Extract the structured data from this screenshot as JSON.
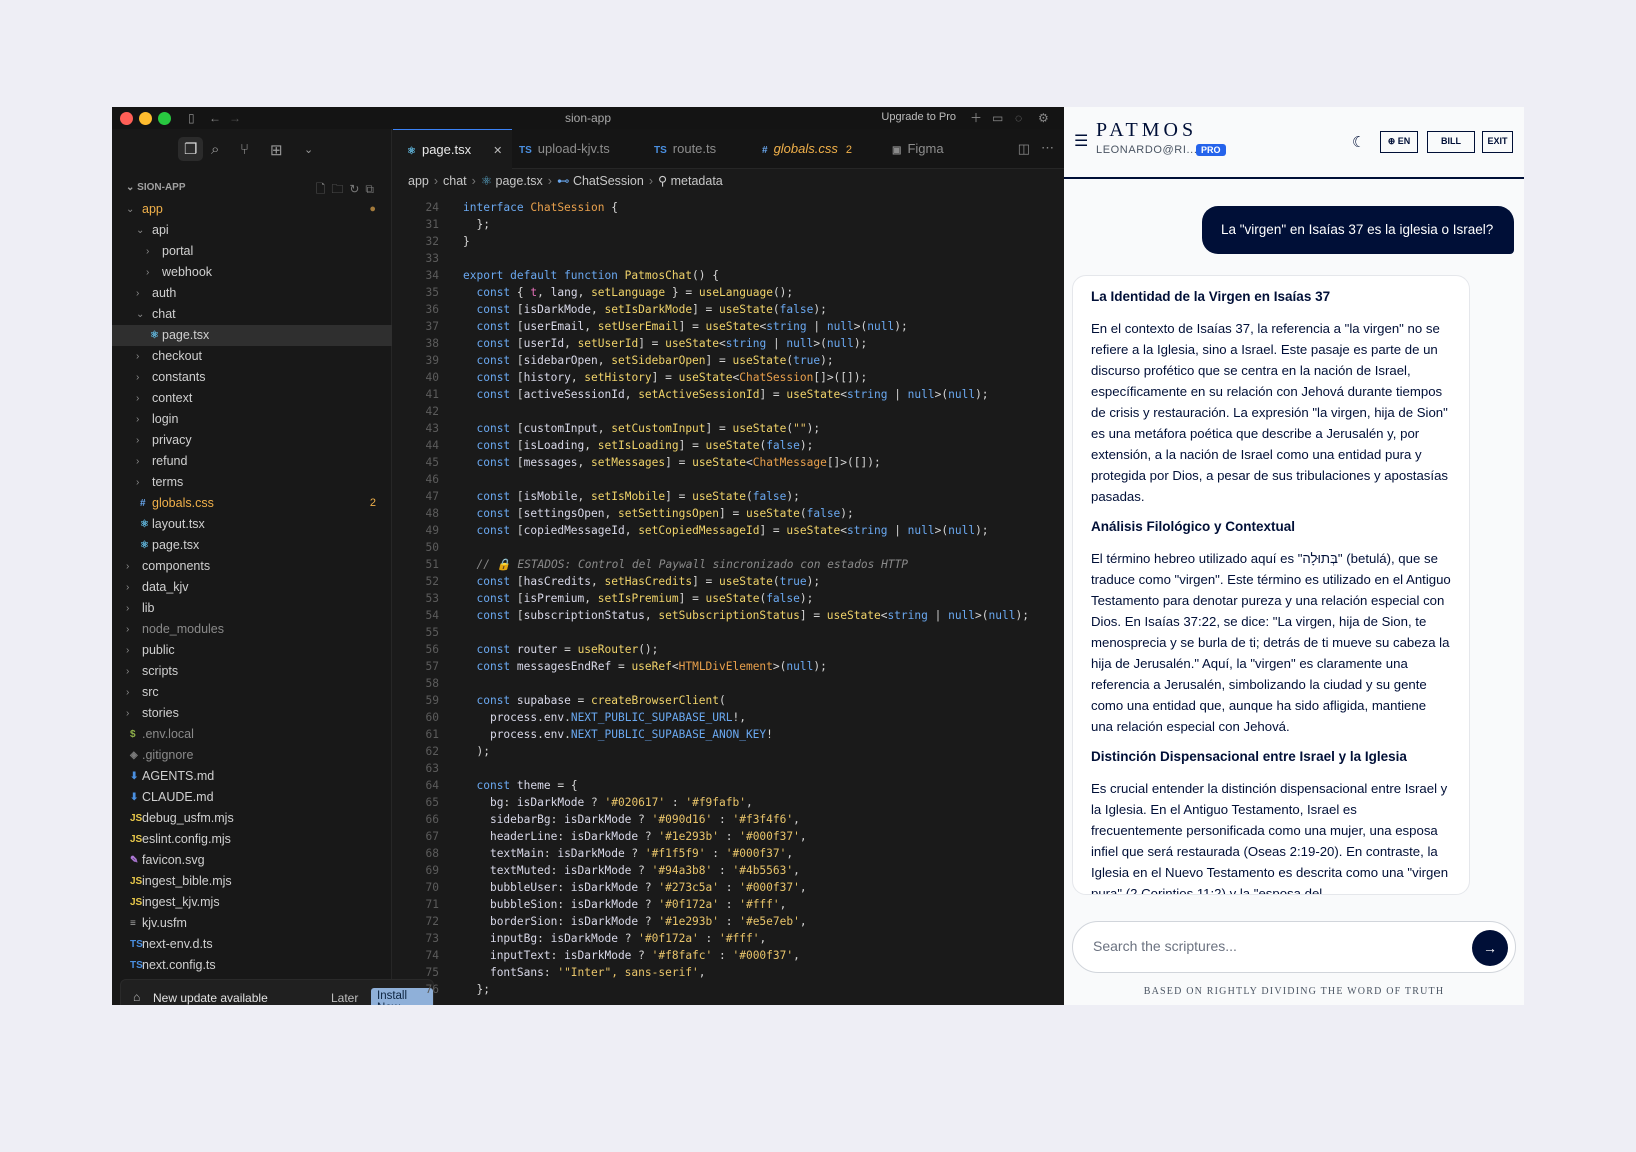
{
  "editor": {
    "window_title": "sion-app",
    "upgrade_label": "Upgrade to Pro",
    "explorer_header": "SION-APP",
    "tree": [
      {
        "name": "app",
        "kind": "folder",
        "open": true,
        "depth": 0,
        "color": "#f0b04a",
        "dot": "#a37a3b"
      },
      {
        "name": "api",
        "kind": "folder",
        "open": true,
        "depth": 1
      },
      {
        "name": "portal",
        "kind": "folder",
        "open": false,
        "depth": 2
      },
      {
        "name": "webhook",
        "kind": "folder",
        "open": false,
        "depth": 2
      },
      {
        "name": "auth",
        "kind": "folder",
        "open": false,
        "depth": 1
      },
      {
        "name": "chat",
        "kind": "folder",
        "open": true,
        "depth": 1
      },
      {
        "name": "page.tsx",
        "kind": "file",
        "icon": "react-icon",
        "depth": 2,
        "selected": true
      },
      {
        "name": "checkout",
        "kind": "folder",
        "open": false,
        "depth": 1
      },
      {
        "name": "constants",
        "kind": "folder",
        "open": false,
        "depth": 1
      },
      {
        "name": "context",
        "kind": "folder",
        "open": false,
        "depth": 1
      },
      {
        "name": "login",
        "kind": "folder",
        "open": false,
        "depth": 1
      },
      {
        "name": "privacy",
        "kind": "folder",
        "open": false,
        "depth": 1
      },
      {
        "name": "refund",
        "kind": "folder",
        "open": false,
        "depth": 1
      },
      {
        "name": "terms",
        "kind": "folder",
        "open": false,
        "depth": 1
      },
      {
        "name": "globals.css",
        "kind": "file",
        "icon": "hash-icon",
        "depth": 1,
        "color": "#f0b04a",
        "badge": "2"
      },
      {
        "name": "layout.tsx",
        "kind": "file",
        "icon": "react-icon",
        "depth": 1
      },
      {
        "name": "page.tsx",
        "kind": "file",
        "icon": "react-icon",
        "depth": 1
      },
      {
        "name": "components",
        "kind": "folder",
        "open": false,
        "depth": 0
      },
      {
        "name": "data_kjv",
        "kind": "folder",
        "open": false,
        "depth": 0
      },
      {
        "name": "lib",
        "kind": "folder",
        "open": false,
        "depth": 0
      },
      {
        "name": "node_modules",
        "kind": "folder",
        "open": false,
        "depth": 0,
        "color": "#8a8a8a"
      },
      {
        "name": "public",
        "kind": "folder",
        "open": false,
        "depth": 0
      },
      {
        "name": "scripts",
        "kind": "folder",
        "open": false,
        "depth": 0
      },
      {
        "name": "src",
        "kind": "folder",
        "open": false,
        "depth": 0
      },
      {
        "name": "stories",
        "kind": "folder",
        "open": false,
        "depth": 0
      },
      {
        "name": ".env.local",
        "kind": "file",
        "icon": "dollar-icon",
        "depth": 0,
        "color": "#8a8a8a"
      },
      {
        "name": ".gitignore",
        "kind": "file",
        "icon": "git-icon",
        "depth": 0,
        "color": "#8a8a8a"
      },
      {
        "name": "AGENTS.md",
        "kind": "file",
        "icon": "markdown-icon",
        "depth": 0
      },
      {
        "name": "CLAUDE.md",
        "kind": "file",
        "icon": "markdown-icon",
        "depth": 0
      },
      {
        "name": "debug_usfm.mjs",
        "kind": "file",
        "icon": "js-icon",
        "depth": 0
      },
      {
        "name": "eslint.config.mjs",
        "kind": "file",
        "icon": "js-icon",
        "depth": 0
      },
      {
        "name": "favicon.svg",
        "kind": "file",
        "icon": "svg-icon",
        "depth": 0
      },
      {
        "name": "ingest_bible.mjs",
        "kind": "file",
        "icon": "js-icon",
        "depth": 0
      },
      {
        "name": "ingest_kjv.mjs",
        "kind": "file",
        "icon": "js-icon",
        "depth": 0
      },
      {
        "name": "kjv.usfm",
        "kind": "file",
        "icon": "lines-icon",
        "depth": 0
      },
      {
        "name": "next-env.d.ts",
        "kind": "file",
        "icon": "ts-icon",
        "depth": 0
      },
      {
        "name": "next.config.ts",
        "kind": "file",
        "icon": "ts-icon",
        "depth": 0
      }
    ],
    "update": {
      "message": "New update available",
      "later": "Later",
      "install": "Install Now"
    },
    "tabs": [
      {
        "label": "page.tsx",
        "icon": "react-icon",
        "active": true,
        "close": "✕"
      },
      {
        "label": "upload-kjv.ts",
        "icon": "ts-icon"
      },
      {
        "label": "route.ts",
        "icon": "ts-icon"
      },
      {
        "label": "globals.css",
        "icon": "hash-icon",
        "badge": "2",
        "italic": true
      },
      {
        "label": "Figma",
        "icon": "figma-icon"
      }
    ],
    "breadcrumb": [
      "app",
      "chat",
      "page.tsx",
      "ChatSession",
      "metadata"
    ],
    "code_lines": [
      {
        "n": "24",
        "html": "<span class=\"kw\">interface</span> <span class=\"ty\">ChatSession</span> {"
      },
      {
        "n": "31",
        "html": "  };"
      },
      {
        "n": "32",
        "html": "}"
      },
      {
        "n": "33",
        "html": ""
      },
      {
        "n": "34",
        "html": "<span class=\"kw\">export default function</span> <span class=\"fn\">PatmosChat</span>() {"
      },
      {
        "n": "35",
        "html": "  <span class=\"kw\">const</span> { <span class=\"vr\">t</span>, <span class=\"pr\">lang</span>, <span class=\"fn\">setLanguage</span> } = <span class=\"fn\">useLanguage</span>();"
      },
      {
        "n": "36",
        "html": "  <span class=\"kw\">const</span> [<span class=\"pr\">isDarkMode</span>, <span class=\"fn\">setIsDarkMode</span>] = <span class=\"fn\">useState</span>(<span class=\"kw\">false</span>);"
      },
      {
        "n": "37",
        "html": "  <span class=\"kw\">const</span> [<span class=\"pr\">userEmail</span>, <span class=\"fn\">setUserEmail</span>] = <span class=\"fn\">useState</span>&lt;<span class=\"kw\">string</span> | <span class=\"kw\">null</span>&gt;(<span class=\"kw\">null</span>);"
      },
      {
        "n": "38",
        "html": "  <span class=\"kw\">const</span> [<span class=\"pr\">userId</span>, <span class=\"fn\">setUserId</span>] = <span class=\"fn\">useState</span>&lt;<span class=\"kw\">string</span> | <span class=\"kw\">null</span>&gt;(<span class=\"kw\">null</span>);"
      },
      {
        "n": "39",
        "html": "  <span class=\"kw\">const</span> [<span class=\"pr\">sidebarOpen</span>, <span class=\"fn\">setSidebarOpen</span>] = <span class=\"fn\">useState</span>(<span class=\"kw\">true</span>);"
      },
      {
        "n": "40",
        "html": "  <span class=\"kw\">const</span> [<span class=\"pr\">history</span>, <span class=\"fn\">setHistory</span>] = <span class=\"fn\">useState</span>&lt;<span class=\"ty\">ChatSession</span>[]&gt;([]);"
      },
      {
        "n": "41",
        "html": "  <span class=\"kw\">const</span> [<span class=\"pr\">activeSessionId</span>, <span class=\"fn\">setActiveSessionId</span>] = <span class=\"fn\">useState</span>&lt;<span class=\"kw\">string</span> | <span class=\"kw\">null</span>&gt;(<span class=\"kw\">null</span>);"
      },
      {
        "n": "42",
        "html": ""
      },
      {
        "n": "43",
        "html": "  <span class=\"kw\">const</span> [<span class=\"pr\">customInput</span>, <span class=\"fn\">setCustomInput</span>] = <span class=\"fn\">useState</span>(<span class=\"str\">\"\"</span>);"
      },
      {
        "n": "44",
        "html": "  <span class=\"kw\">const</span> [<span class=\"pr\">isLoading</span>, <span class=\"fn\">setIsLoading</span>] = <span class=\"fn\">useState</span>(<span class=\"kw\">false</span>);"
      },
      {
        "n": "45",
        "html": "  <span class=\"kw\">const</span> [<span class=\"pr\">messages</span>, <span class=\"fn\">setMessages</span>] = <span class=\"fn\">useState</span>&lt;<span class=\"ty\">ChatMessage</span>[]&gt;([]);"
      },
      {
        "n": "46",
        "html": ""
      },
      {
        "n": "47",
        "html": "  <span class=\"kw\">const</span> [<span class=\"pr\">isMobile</span>, <span class=\"fn\">setIsMobile</span>] = <span class=\"fn\">useState</span>(<span class=\"kw\">false</span>);"
      },
      {
        "n": "48",
        "html": "  <span class=\"kw\">const</span> [<span class=\"pr\">settingsOpen</span>, <span class=\"fn\">setSettingsOpen</span>] = <span class=\"fn\">useState</span>(<span class=\"kw\">false</span>);"
      },
      {
        "n": "49",
        "html": "  <span class=\"kw\">const</span> [<span class=\"pr\">copiedMessageId</span>, <span class=\"fn\">setCopiedMessageId</span>] = <span class=\"fn\">useState</span>&lt;<span class=\"kw\">string</span> | <span class=\"kw\">null</span>&gt;(<span class=\"kw\">null</span>);"
      },
      {
        "n": "50",
        "html": ""
      },
      {
        "n": "51",
        "html": "  <span class=\"cm\">// 🔒 ESTADOS: Control del Paywall sincronizado con estados HTTP</span>"
      },
      {
        "n": "52",
        "html": "  <span class=\"kw\">const</span> [<span class=\"pr\">hasCredits</span>, <span class=\"fn\">setHasCredits</span>] = <span class=\"fn\">useState</span>(<span class=\"kw\">true</span>);"
      },
      {
        "n": "53",
        "html": "  <span class=\"kw\">const</span> [<span class=\"pr\">isPremium</span>, <span class=\"fn\">setIsPremium</span>] = <span class=\"fn\">useState</span>(<span class=\"kw\">false</span>);"
      },
      {
        "n": "54",
        "html": "  <span class=\"kw\">const</span> [<span class=\"pr\">subscriptionStatus</span>, <span class=\"fn\">setSubscriptionStatus</span>] = <span class=\"fn\">useState</span>&lt;<span class=\"kw\">string</span> | <span class=\"kw\">null</span>&gt;(<span class=\"kw\">null</span>);"
      },
      {
        "n": "55",
        "html": ""
      },
      {
        "n": "56",
        "html": "  <span class=\"kw\">const</span> <span class=\"pr\">router</span> = <span class=\"fn\">useRouter</span>();"
      },
      {
        "n": "57",
        "html": "  <span class=\"kw\">const</span> <span class=\"pr\">messagesEndRef</span> = <span class=\"fn\">useRef</span>&lt;<span class=\"ty\">HTMLDivElement</span>&gt;(<span class=\"kw\">null</span>);"
      },
      {
        "n": "58",
        "html": ""
      },
      {
        "n": "59",
        "html": "  <span class=\"kw\">const</span> <span class=\"pr\">supabase</span> = <span class=\"fn\">createBrowserClient</span>("
      },
      {
        "n": "60",
        "html": "    <span class=\"pr\">process</span>.<span class=\"pr\">env</span>.<span class=\"kw\">NEXT_PUBLIC_SUPABASE_URL</span>!,"
      },
      {
        "n": "61",
        "html": "    <span class=\"pr\">process</span>.<span class=\"pr\">env</span>.<span class=\"kw\">NEXT_PUBLIC_SUPABASE_ANON_KEY</span>!"
      },
      {
        "n": "62",
        "html": "  );"
      },
      {
        "n": "63",
        "html": ""
      },
      {
        "n": "64",
        "html": "  <span class=\"kw\">const</span> <span class=\"pr\">theme</span> = {"
      },
      {
        "n": "65",
        "html": "    <span class=\"pr\">bg</span>: <span class=\"pr\">isDarkMode</span> ? <span class=\"str\">'#020617'</span> : <span class=\"str\">'#f9fafb'</span>,"
      },
      {
        "n": "66",
        "html": "    <span class=\"pr\">sidebarBg</span>: <span class=\"pr\">isDarkMode</span> ? <span class=\"str\">'#090d16'</span> : <span class=\"str\">'#f3f4f6'</span>,"
      },
      {
        "n": "67",
        "html": "    <span class=\"pr\">headerLine</span>: <span class=\"pr\">isDarkMode</span> ? <span class=\"str\">'#1e293b'</span> : <span class=\"str\">'#000f37'</span>,"
      },
      {
        "n": "68",
        "html": "    <span class=\"pr\">textMain</span>: <span class=\"pr\">isDarkMode</span> ? <span class=\"str\">'#f1f5f9'</span> : <span class=\"str\">'#000f37'</span>,"
      },
      {
        "n": "69",
        "html": "    <span class=\"pr\">textMuted</span>: <span class=\"pr\">isDarkMode</span> ? <span class=\"str\">'#94a3b8'</span> : <span class=\"str\">'#4b5563'</span>,"
      },
      {
        "n": "70",
        "html": "    <span class=\"pr\">bubbleUser</span>: <span class=\"pr\">isDarkMode</span> ? <span class=\"str\">'#273c5a'</span> : <span class=\"str\">'#000f37'</span>,"
      },
      {
        "n": "71",
        "html": "    <span class=\"pr\">bubbleSion</span>: <span class=\"pr\">isDarkMode</span> ? <span class=\"str\">'#0f172a'</span> : <span class=\"str\">'#fff'</span>,"
      },
      {
        "n": "72",
        "html": "    <span class=\"pr\">borderSion</span>: <span class=\"pr\">isDarkMode</span> ? <span class=\"str\">'#1e293b'</span> : <span class=\"str\">'#e5e7eb'</span>,"
      },
      {
        "n": "73",
        "html": "    <span class=\"pr\">inputBg</span>: <span class=\"pr\">isDarkMode</span> ? <span class=\"str\">'#0f172a'</span> : <span class=\"str\">'#fff'</span>,"
      },
      {
        "n": "74",
        "html": "    <span class=\"pr\">inputText</span>: <span class=\"pr\">isDarkMode</span> ? <span class=\"str\">'#f8fafc'</span> : <span class=\"str\">'#000f37'</span>,"
      },
      {
        "n": "75",
        "html": "    <span class=\"pr\">fontSans</span>: <span class=\"str\">'\"Inter\", sans-serif'</span>,"
      },
      {
        "n": "76",
        "html": "  };"
      }
    ]
  },
  "chat": {
    "brand": "PATMOS",
    "user": "LEONARDO@RI...",
    "pro_badge": "PRO",
    "lang_btn": "EN",
    "bill_btn": "BILL",
    "exit_btn": "EXIT",
    "user_message": "La \"virgen\" en Isaías 37 es la iglesia o Israel?",
    "answer": [
      {
        "type": "h",
        "text": "La Identidad de la Virgen en Isaías 37"
      },
      {
        "type": "p",
        "text": "En el contexto de Isaías 37, la referencia a \"la virgen\" no se refiere a la Iglesia, sino a Israel. Este pasaje es parte de un discurso profético que se centra en la nación de Israel, específicamente en su relación con Jehová durante tiempos de crisis y restauración. La expresión \"la virgen, hija de Sion\" es una metáfora poética que describe a Jerusalén y, por extensión, a la nación de Israel como una entidad pura y protegida por Dios, a pesar de sus tribulaciones y apostasías pasadas."
      },
      {
        "type": "h",
        "text": "Análisis Filológico y Contextual"
      },
      {
        "type": "p",
        "text": "El término hebreo utilizado aquí es \"בְּתוּלָה\" (betulá), que se traduce como \"virgen\". Este término es utilizado en el Antiguo Testamento para denotar pureza y una relación especial con Dios. En Isaías 37:22, se dice: \"La virgen, hija de Sion, te menosprecia y se burla de ti; detrás de ti mueve su cabeza la hija de Jerusalén.\" Aquí, la \"virgen\" es claramente una referencia a Jerusalén, simbolizando la ciudad y su gente como una entidad que, aunque ha sido afligida, mantiene una relación especial con Jehová."
      },
      {
        "type": "h",
        "text": "Distinción Dispensacional entre Israel y la Iglesia"
      },
      {
        "type": "p",
        "text": "Es crucial entender la distinción dispensacional entre Israel y la Iglesia. En el Antiguo Testamento, Israel es frecuentemente personificada como una mujer, una esposa infiel que será restaurada (Oseas 2:19-20). En contraste, la Iglesia en el Nuevo Testamento es descrita como una \"virgen pura\" (2 Corintios 11:2) y la \"esposa del"
      }
    ],
    "search_placeholder": "Search the scriptures...",
    "footer": "BASED ON RIGHTLY DIVIDING THE WORD OF TRUTH"
  }
}
